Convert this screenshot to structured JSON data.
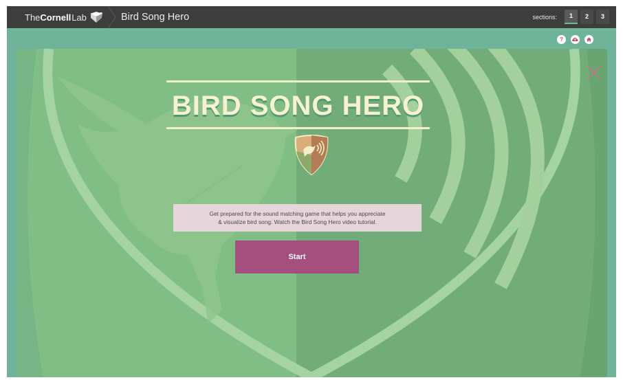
{
  "header": {
    "logo_prefix": "The",
    "logo_brand": "Cornell",
    "logo_suffix": "Lab",
    "app_title": "Bird Song Hero",
    "sections_label": "sections:",
    "sections": [
      "1",
      "2",
      "3"
    ],
    "active_section": "1"
  },
  "toolbar": {
    "help_label": "?",
    "icons": [
      "help-icon",
      "cloud-icon",
      "home-icon"
    ]
  },
  "game": {
    "title": "BIRD SONG HERO",
    "description_line1": "Get prepared for the sound matching game that helps you appreciate",
    "description_line2": "& visualize bird song. Watch the Bird Song Hero video tutorial.",
    "start_label": "Start"
  },
  "colors": {
    "topbar": "#3d3d3d",
    "accent_green": "#6bbd8f",
    "start_button": "#a44f7d",
    "description_bg": "#e6d6db",
    "title_text": "#f6f1d2"
  }
}
